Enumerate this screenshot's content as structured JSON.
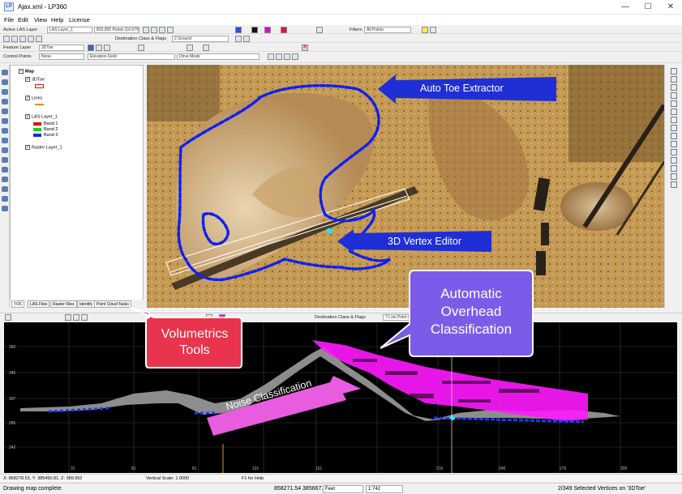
{
  "window": {
    "title": "Ajax.xml - LP360",
    "logo": "LP",
    "buttons": {
      "minimize": "—",
      "maximize": "☐",
      "close": "✕"
    }
  },
  "menu": [
    "File",
    "Edit",
    "View",
    "Help",
    "License"
  ],
  "toolbar1": {
    "active_las_label": "Active LAS Layer",
    "las_layer_value": "LAS Layer_1",
    "points_value": "833,005 Points (16.67%)",
    "filters_label": "Filters:",
    "filters_value": "All Points"
  },
  "toolbar2": {
    "destination_label": "Destination Class & Flags",
    "destination_value": "2 Ground"
  },
  "toolbar3": {
    "feature_layer_label": "Feature Layer",
    "feature_layer_value": "3DToe"
  },
  "toolbar4": {
    "control_points_label": "Control Points",
    "control_points_value": "None",
    "elevation_field_value": "Elevation Field",
    "drive_mode_value": "Drive Mode"
  },
  "toc": {
    "root": "Map",
    "layers": [
      {
        "name": "3DToe",
        "checked": true
      },
      {
        "name": "Lines",
        "checked": true
      },
      {
        "name": "LAS Layer_1",
        "checked": true
      },
      {
        "name": "Raster Layer_1",
        "checked": true
      }
    ],
    "bands": [
      {
        "name": "Band 1",
        "color": "#e81010"
      },
      {
        "name": "Band 2",
        "color": "#22cc22"
      },
      {
        "name": "Band 3",
        "color": "#1a2bd8"
      }
    ],
    "tabs": [
      "TOC",
      "LAS Files",
      "Raster Files",
      "Identify",
      "Point Cloud Tasks"
    ]
  },
  "profile_toolbar": {
    "destination_label": "Destination Class & Flags",
    "low_point_value": "7 Low Point (noi"
  },
  "profile": {
    "y_ticks": [
      "392",
      "340",
      "307",
      "285",
      "242"
    ],
    "x_ticks": [
      "31",
      "81",
      "81",
      "101",
      "151",
      "216",
      "246",
      "276",
      "300"
    ]
  },
  "callouts": {
    "auto_toe": "Auto Toe Extractor",
    "vertex_editor": "3D Vertex Editor",
    "overhead": "Automatic Overhead Classification",
    "volumetrics": "Volumetrics Tools",
    "noise": "Noise Classification"
  },
  "status_line": {
    "coords": "X: 858278.53, Y: 385450.81, Z: 389.952",
    "vertical_scale": "Vertical Scale: 1.0000",
    "help": "F1 for Help"
  },
  "status_bar": {
    "message": "Drawing map complete.",
    "coords": "858271.54 385667.2",
    "units": "Feet",
    "scale": "1:742",
    "selection": "2/349 Selected Vertices on '3DToe'"
  },
  "colors": {
    "callout_blue": "#1f2fd6",
    "callout_purple": "#7b5ce8",
    "callout_red": "#e8344c",
    "callout_pink": "#e85ce0",
    "profile_magenta": "#ff1aff",
    "toe_blue": "#1020f0"
  }
}
